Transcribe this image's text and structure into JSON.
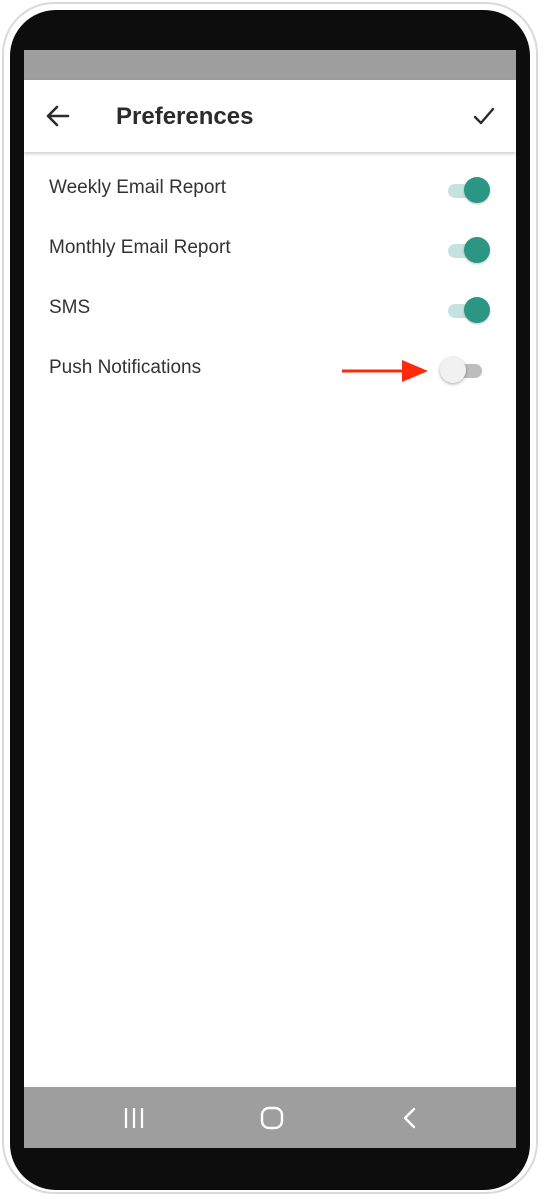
{
  "app_bar": {
    "title": "Preferences",
    "back_icon": "arrow-left-icon",
    "confirm_icon": "checkmark-icon"
  },
  "preferences": [
    {
      "label": "Weekly Email Report",
      "enabled": true
    },
    {
      "label": "Monthly Email Report",
      "enabled": true
    },
    {
      "label": "SMS",
      "enabled": true
    },
    {
      "label": "Push Notifications",
      "enabled": false
    }
  ],
  "annotation": {
    "icon": "red-arrow-icon",
    "color": "#ff2a0c"
  },
  "nav_bar": {
    "recents_icon": "recents-icon",
    "home_icon": "home-icon",
    "back_icon": "back-chevron-icon"
  },
  "colors": {
    "accent": "#2a9683",
    "accent_track": "#c5e3de",
    "system_bar": "#9e9e9e"
  }
}
